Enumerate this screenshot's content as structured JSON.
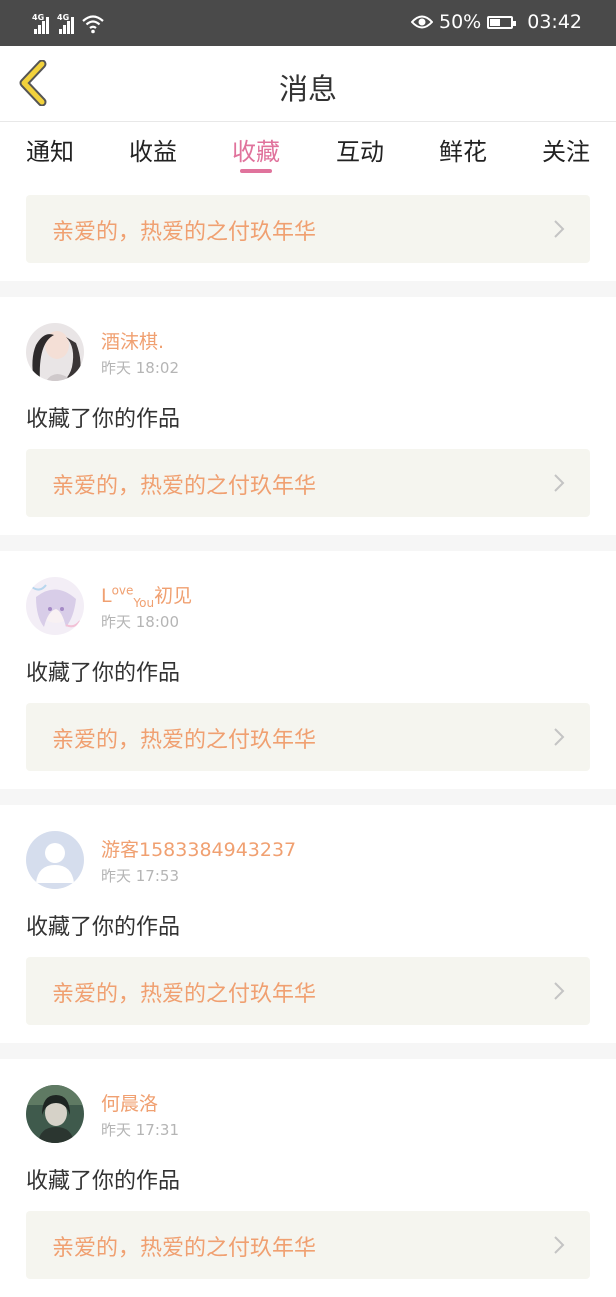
{
  "status_bar": {
    "signal_1": "4G",
    "signal_2": "4G",
    "battery_percent": "50%",
    "battery_level": 0.5,
    "time": "03:42",
    "icons": [
      "signal-icon",
      "signal-icon",
      "wifi-icon",
      "eye-icon",
      "battery-icon"
    ]
  },
  "header": {
    "title": "消息",
    "back_icon": "back-chevron-icon",
    "back_color": "#f2d23c"
  },
  "tabs": [
    {
      "label": "通知",
      "active": false
    },
    {
      "label": "收益",
      "active": false
    },
    {
      "label": "收藏",
      "active": true
    },
    {
      "label": "互动",
      "active": false
    },
    {
      "label": "鲜花",
      "active": false
    },
    {
      "label": "关注",
      "active": false
    }
  ],
  "top_card": {
    "title": "亲爱的，热爱的之付玖年华"
  },
  "items": [
    {
      "username": "酒沫棋.",
      "time": "昨天 18:02",
      "action": "收藏了你的作品",
      "work_title": "亲爱的，热爱的之付玖年华",
      "avatar": "photo-avatar-dark"
    },
    {
      "username_parts": [
        "L",
        "ove",
        "You",
        "初见"
      ],
      "time": "昨天 18:00",
      "action": "收藏了你的作品",
      "work_title": "亲爱的，热爱的之付玖年华",
      "avatar": "anime-avatar"
    },
    {
      "username": "游客1583384943237",
      "time": "昨天 17:53",
      "action": "收藏了你的作品",
      "work_title": "亲爱的，热爱的之付玖年华",
      "avatar": "default-user-avatar"
    },
    {
      "username": "何晨洛",
      "time": "昨天 17:31",
      "action": "收藏了你的作品",
      "work_title": "亲爱的，热爱的之付玖年华",
      "avatar": "photo-avatar-green"
    }
  ],
  "colors": {
    "accent_pink": "#e0739c",
    "username_orange": "#f0a071",
    "card_bg": "#f5f5ef",
    "status_bar_bg": "#4a4a4a"
  }
}
